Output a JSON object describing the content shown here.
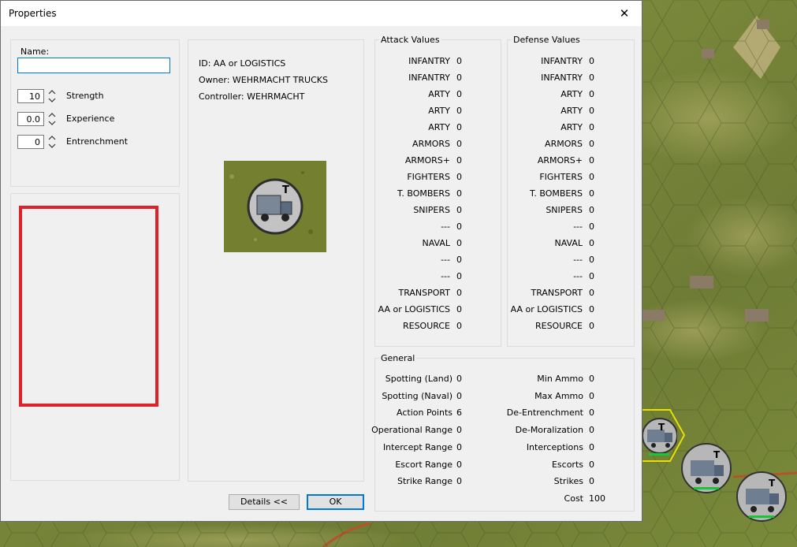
{
  "dialog": {
    "title": "Properties",
    "close_glyph": "✕",
    "name_label": "Name:",
    "name_value": "",
    "spinners": [
      {
        "value": "10",
        "label": "Strength"
      },
      {
        "value": "0.0",
        "label": "Experience"
      },
      {
        "value": "0",
        "label": "Entrenchment"
      }
    ],
    "info": {
      "id": "ID: AA or LOGISTICS",
      "owner": "Owner: WEHRMACHT TRUCKS",
      "controller": "Controller: WEHRMACHT"
    },
    "unit_icon": "truck-unit-icon",
    "unit_badge": "T",
    "highlight_color": "#e0202a",
    "attack": {
      "title": "Attack Values",
      "rows": [
        {
          "label": "INFANTRY",
          "value": "0"
        },
        {
          "label": "INFANTRY",
          "value": "0"
        },
        {
          "label": "ARTY",
          "value": "0"
        },
        {
          "label": "ARTY",
          "value": "0"
        },
        {
          "label": "ARTY",
          "value": "0"
        },
        {
          "label": "ARMORS",
          "value": "0"
        },
        {
          "label": "ARMORS+",
          "value": "0"
        },
        {
          "label": "FIGHTERS",
          "value": "0"
        },
        {
          "label": "T. BOMBERS",
          "value": "0"
        },
        {
          "label": "SNIPERS",
          "value": "0"
        },
        {
          "label": "---",
          "value": "0"
        },
        {
          "label": "NAVAL",
          "value": "0"
        },
        {
          "label": "---",
          "value": "0"
        },
        {
          "label": "---",
          "value": "0"
        },
        {
          "label": "TRANSPORT",
          "value": "0"
        },
        {
          "label": "AA or LOGISTICS",
          "value": "0"
        },
        {
          "label": "RESOURCE",
          "value": "0"
        }
      ]
    },
    "defense": {
      "title": "Defense Values",
      "rows": [
        {
          "label": "INFANTRY",
          "value": "0"
        },
        {
          "label": "INFANTRY",
          "value": "0"
        },
        {
          "label": "ARTY",
          "value": "0"
        },
        {
          "label": "ARTY",
          "value": "0"
        },
        {
          "label": "ARTY",
          "value": "0"
        },
        {
          "label": "ARMORS",
          "value": "0"
        },
        {
          "label": "ARMORS+",
          "value": "0"
        },
        {
          "label": "FIGHTERS",
          "value": "0"
        },
        {
          "label": "T. BOMBERS",
          "value": "0"
        },
        {
          "label": "SNIPERS",
          "value": "0"
        },
        {
          "label": "---",
          "value": "0"
        },
        {
          "label": "NAVAL",
          "value": "0"
        },
        {
          "label": "---",
          "value": "0"
        },
        {
          "label": "---",
          "value": "0"
        },
        {
          "label": "TRANSPORT",
          "value": "0"
        },
        {
          "label": "AA or LOGISTICS",
          "value": "0"
        },
        {
          "label": "RESOURCE",
          "value": "0"
        }
      ]
    },
    "general": {
      "title": "General",
      "left": [
        {
          "label": "Spotting (Land)",
          "value": "0"
        },
        {
          "label": "Spotting (Naval)",
          "value": "0"
        },
        {
          "label": "Action Points",
          "value": "6"
        },
        {
          "label": "Operational Range",
          "value": "0"
        },
        {
          "label": "Intercept Range",
          "value": "0"
        },
        {
          "label": "Escort Range",
          "value": "0"
        },
        {
          "label": "Strike Range",
          "value": "0"
        }
      ],
      "right": [
        {
          "label": "Min Ammo",
          "value": "0"
        },
        {
          "label": "Max Ammo",
          "value": "0"
        },
        {
          "label": "De-Entrenchment",
          "value": "0"
        },
        {
          "label": "De-Moralization",
          "value": "0"
        },
        {
          "label": "Interceptions",
          "value": "0"
        },
        {
          "label": "Escorts",
          "value": "0"
        },
        {
          "label": "Strikes",
          "value": "0"
        },
        {
          "label": "Cost",
          "value": "100"
        }
      ]
    },
    "buttons": {
      "details": "Details <<",
      "ok": "OK"
    }
  },
  "map": {
    "units": [
      {
        "badge": "T"
      },
      {
        "badge": "T"
      },
      {
        "badge": "T"
      }
    ]
  }
}
